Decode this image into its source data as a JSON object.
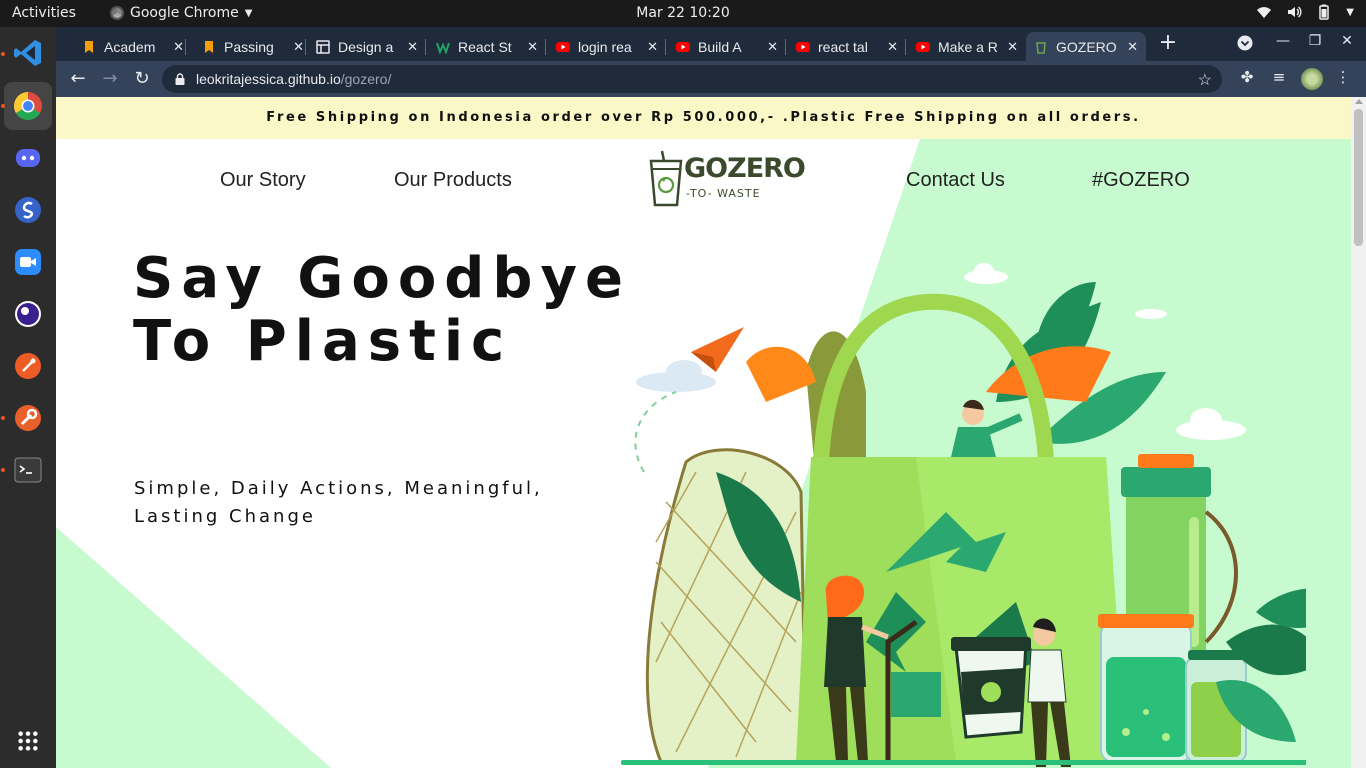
{
  "topbar": {
    "activities": "Activities",
    "app_name": "Google Chrome",
    "clock": "Mar 22  10:20"
  },
  "dock": {
    "items": [
      {
        "name": "vscode",
        "color": "#2f8fe0"
      },
      {
        "name": "chrome",
        "color": "#dd4b3e"
      },
      {
        "name": "discord",
        "color": "#5865f2"
      },
      {
        "name": "simplenote",
        "color": "#3563c8"
      },
      {
        "name": "zoom",
        "color": "#2d8cff"
      },
      {
        "name": "purple-app",
        "color": "#5b2fb8"
      },
      {
        "name": "postman",
        "color": "#ef5b25"
      },
      {
        "name": "insomnia",
        "color": "#e8602c"
      },
      {
        "name": "terminal",
        "color": "#3a3a3a"
      }
    ]
  },
  "browser": {
    "tabs": [
      {
        "title": "Academ",
        "favicon": "bookmark",
        "color": "#f59e0b"
      },
      {
        "title": "Passing",
        "favicon": "bookmark",
        "color": "#f59e0b"
      },
      {
        "title": "Design a",
        "favicon": "layout",
        "color": "#e8eaed"
      },
      {
        "title": "React St",
        "favicon": "w-logo",
        "color": "#21a366"
      },
      {
        "title": "login rea",
        "favicon": "youtube",
        "color": "#ff0000"
      },
      {
        "title": "Build A",
        "favicon": "youtube",
        "color": "#ff0000"
      },
      {
        "title": "react tal",
        "favicon": "youtube",
        "color": "#ff0000"
      },
      {
        "title": "Make a R",
        "favicon": "youtube",
        "color": "#ff0000"
      },
      {
        "title": "GOZERO",
        "favicon": "gozero",
        "color": "#6aa84f"
      }
    ],
    "url_host": "leokritajessica.github.io",
    "url_path": "/gozero/"
  },
  "page": {
    "banner": "Free Shipping on Indonesia order over Rp 500.000,- .Plastic Free Shipping on all orders.",
    "nav": {
      "our_story": "Our Story",
      "our_products": "Our Products",
      "contact_us": "Contact Us",
      "hashtag": "#GOZERO"
    },
    "logo": {
      "main": "GOZERO",
      "sub": "-TO- WASTE"
    },
    "hero": {
      "title": "Say Goodbye To Plastic",
      "subtitle": "Simple, Daily Actions, Meaningful, Lasting Change"
    },
    "colors": {
      "banner_bg": "#fbf8c8",
      "accent_mint": "#c8fad0",
      "brand_green": "#3b4a2c"
    }
  }
}
